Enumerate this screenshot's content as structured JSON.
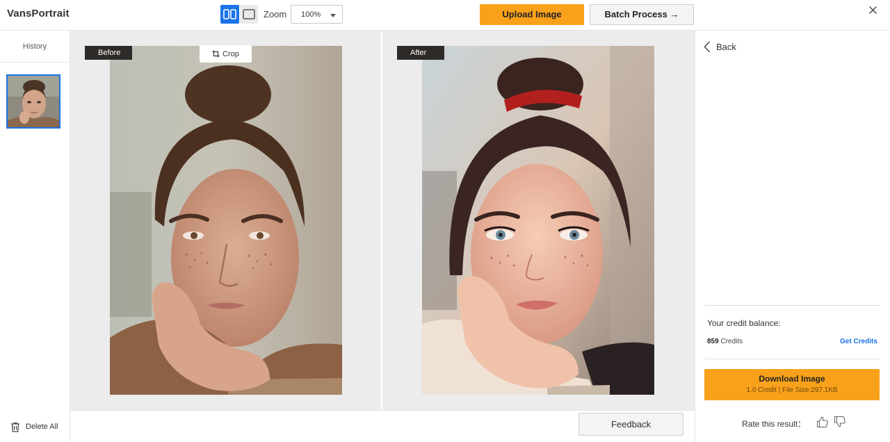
{
  "header": {
    "logo": "VansPortrait",
    "view_split_icon": "split-view-icon",
    "view_single_icon": "single-view-icon",
    "zoom_label": "Zoom",
    "zoom_value": "100%",
    "upload_label": "Upload Image",
    "batch_label": "Batch Process →",
    "close_icon": "close-icon",
    "accent_color": "#1a73e8",
    "primary_button_color": "#f9a11b"
  },
  "sidebar": {
    "history_label": "History",
    "delete_label": "Delete All",
    "delete_icon": "trash-icon"
  },
  "canvas": {
    "before_label": "Before",
    "after_label": "After",
    "crop_label": "Crop",
    "crop_icon": "crop-icon"
  },
  "bottom": {
    "feedback_label": "Feedback"
  },
  "right_panel": {
    "back_label": "Back",
    "back_icon": "chevron-left-icon",
    "credit_title": "Your credit balance:",
    "credits_count": "859",
    "credits_unit": "Credits",
    "get_credits_label": "Get Credits",
    "download_label": "Download Image",
    "download_sub": "1.0 Credit | File Size:297.1KB",
    "rate_label": "Rate this result：",
    "thumbs_up_icon": "thumbs-up-icon",
    "thumbs_down_icon": "thumbs-down-icon"
  }
}
